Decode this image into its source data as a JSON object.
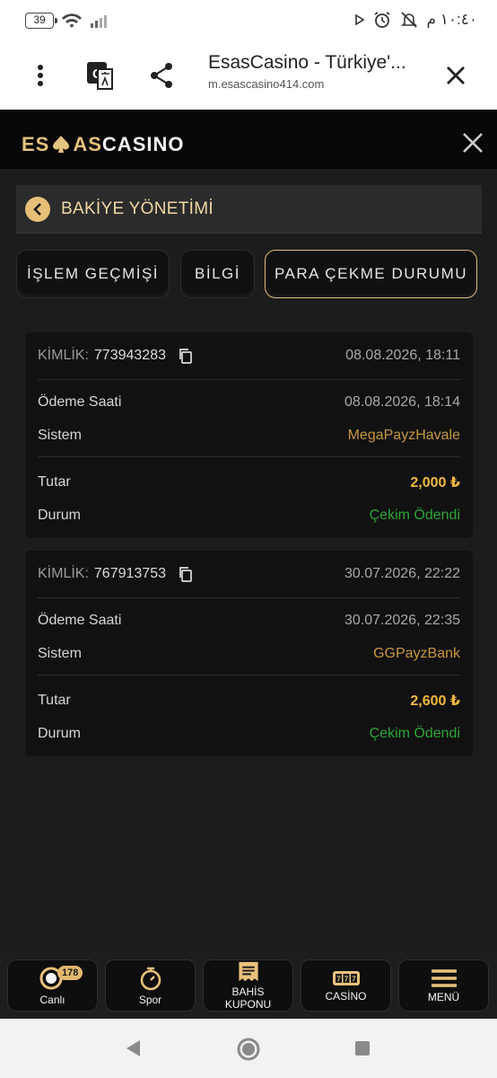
{
  "status_bar": {
    "battery": "39",
    "time": "١٠:٤٠ م"
  },
  "browser": {
    "title": "EsasCasino - Türkiye'...",
    "url": "m.esascasino414.com"
  },
  "site": {
    "logo_esas": "ES",
    "logo_as": "AS",
    "logo_casino": "CASINO"
  },
  "page": {
    "title": "BAKİYE YÖNETİMİ"
  },
  "tabs": [
    {
      "label": "İŞLEM GEÇMİŞİ",
      "active": false
    },
    {
      "label": "BİLGİ",
      "active": false
    },
    {
      "label": "PARA ÇEKME DURUMU",
      "active": true
    }
  ],
  "labels": {
    "id": "KİMLİK:",
    "payment_time": "Ödeme Saati",
    "system": "Sistem",
    "amount": "Tutar",
    "status": "Durum"
  },
  "withdrawals": [
    {
      "id": "773943283",
      "created": "08.08.2026, 18:11",
      "payment_time": "08.08.2026, 18:14",
      "system": "MegaPayzHavale",
      "amount": "2,000 ₺",
      "status": "Çekim Ödendi"
    },
    {
      "id": "767913753",
      "created": "30.07.2026, 22:22",
      "payment_time": "30.07.2026, 22:35",
      "system": "GGPayzBank",
      "amount": "2,600 ₺",
      "status": "Çekim Ödendi"
    }
  ],
  "bottom_nav": [
    {
      "label": "Canlı",
      "icon": "live-icon",
      "badge": "178"
    },
    {
      "label": "Spor",
      "icon": "stopwatch-icon"
    },
    {
      "label": "BAHİS KUPONU",
      "icon": "betslip-icon"
    },
    {
      "label": "CASİNO",
      "icon": "slot-icon"
    },
    {
      "label": "MENÜ",
      "icon": "menu-icon"
    }
  ],
  "colors": {
    "accent": "#e6bf79",
    "amount": "#f1b93c",
    "system": "#c7973f",
    "status_paid": "#2fa438"
  }
}
